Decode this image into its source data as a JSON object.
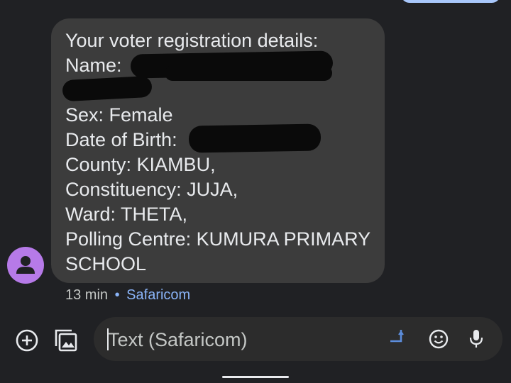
{
  "message": {
    "lines": [
      "Your voter registration details:",
      "Name:",
      "",
      "Sex: Female",
      "Date of Birth:",
      "County: KIAMBU,",
      "Constituency: JUJA,",
      "Ward: THETA,",
      "Polling Centre: KUMURA PRIMARY",
      "SCHOOL"
    ]
  },
  "meta": {
    "time": "13 min",
    "separator": "•",
    "sender": "Safaricom"
  },
  "compose": {
    "placeholder": "Text (Safaricom)"
  },
  "icons": {
    "add": "add-circle-icon",
    "gallery": "gallery-icon",
    "sim": "sim-select-icon",
    "emoji": "emoji-icon",
    "mic": "microphone-icon",
    "avatar": "person-icon"
  },
  "colors": {
    "background": "#202124",
    "bubble": "#3c3c3c",
    "avatar": "#b67ae8",
    "accent": "#8ab4f8"
  }
}
